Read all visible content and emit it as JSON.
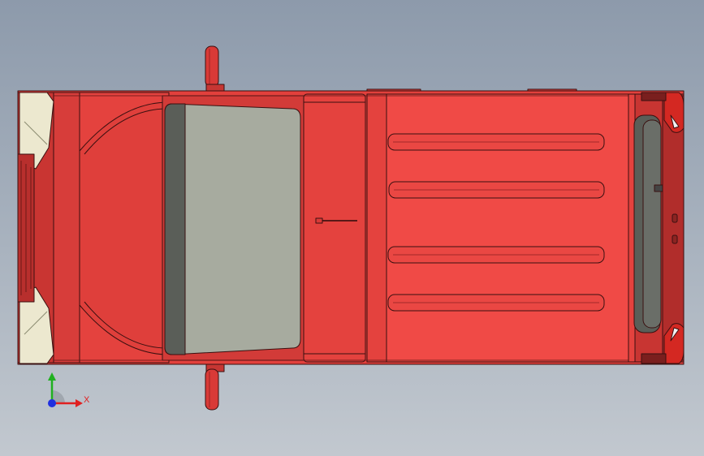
{
  "viewport": {
    "background_top": "#8d9aab",
    "background_bottom": "#c2c8cf"
  },
  "model": {
    "view": "top",
    "body_color": "#e8433f",
    "roof_color": "#f04a46",
    "glass_color": "#a7ab9f",
    "headlight_color": "#ece8cf",
    "outline_color": "#3a1010"
  },
  "triad": {
    "x_label": "X",
    "y_label": "Y",
    "x_color": "#e02020",
    "y_color": "#20b020",
    "z_color": "#2030e0"
  }
}
